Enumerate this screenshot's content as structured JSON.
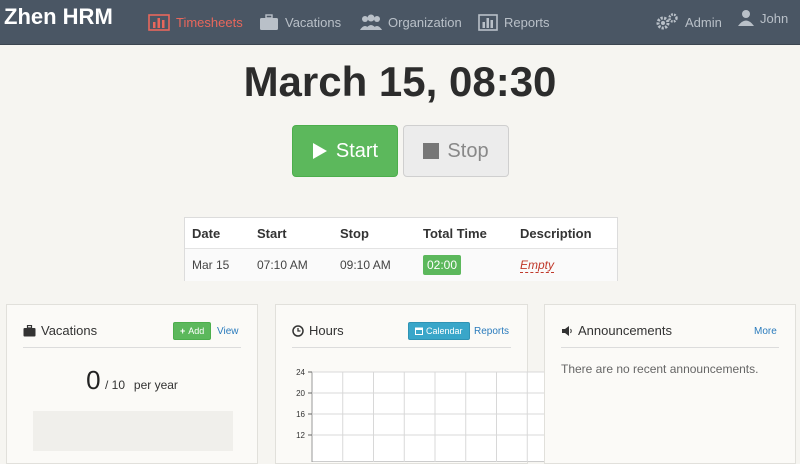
{
  "app": {
    "brand": "Zhen HRM"
  },
  "nav": {
    "items": [
      {
        "label": "Timesheets",
        "icon": "bar-chart-icon",
        "active": true
      },
      {
        "label": "Vacations",
        "icon": "briefcase-icon",
        "active": false
      },
      {
        "label": "Organization",
        "icon": "users-icon",
        "active": false
      },
      {
        "label": "Reports",
        "icon": "bar-chart-icon",
        "active": false
      }
    ],
    "right": [
      {
        "label": "Admin",
        "icon": "gears-icon"
      },
      {
        "label": "John",
        "icon": "user-icon"
      }
    ]
  },
  "clock": {
    "datetime": "March 15, 08:30"
  },
  "controls": {
    "start_label": "Start",
    "stop_label": "Stop"
  },
  "timesheet": {
    "columns": [
      "Date",
      "Start",
      "Stop",
      "Total Time",
      "Description"
    ],
    "rows": [
      {
        "date": "Mar 15",
        "start": "07:10 AM",
        "stop": "09:10 AM",
        "total": "02:00",
        "description": "Empty"
      }
    ]
  },
  "vacations_panel": {
    "title": "Vacations",
    "add_label": "Add",
    "view_label": "View",
    "used": "0",
    "total": "/ 10",
    "unit": "per year"
  },
  "hours_panel": {
    "title": "Hours",
    "calendar_label": "Calendar",
    "reports_label": "Reports"
  },
  "announcements_panel": {
    "title": "Announcements",
    "more_label": "More",
    "empty_text": "There are no recent announcements."
  },
  "colors": {
    "navbar": "#4a5664",
    "active_nav": "#e8675c",
    "start": "#5cb85c",
    "calendar_button": "#39a6c9",
    "link": "#2a7bbd"
  },
  "chart_data": {
    "type": "bar",
    "categories": [],
    "series": [],
    "title": "",
    "xlabel": "",
    "ylabel": "",
    "yticks": [
      24,
      20,
      16,
      12
    ],
    "ylim": [
      0,
      24
    ],
    "grid": true
  }
}
